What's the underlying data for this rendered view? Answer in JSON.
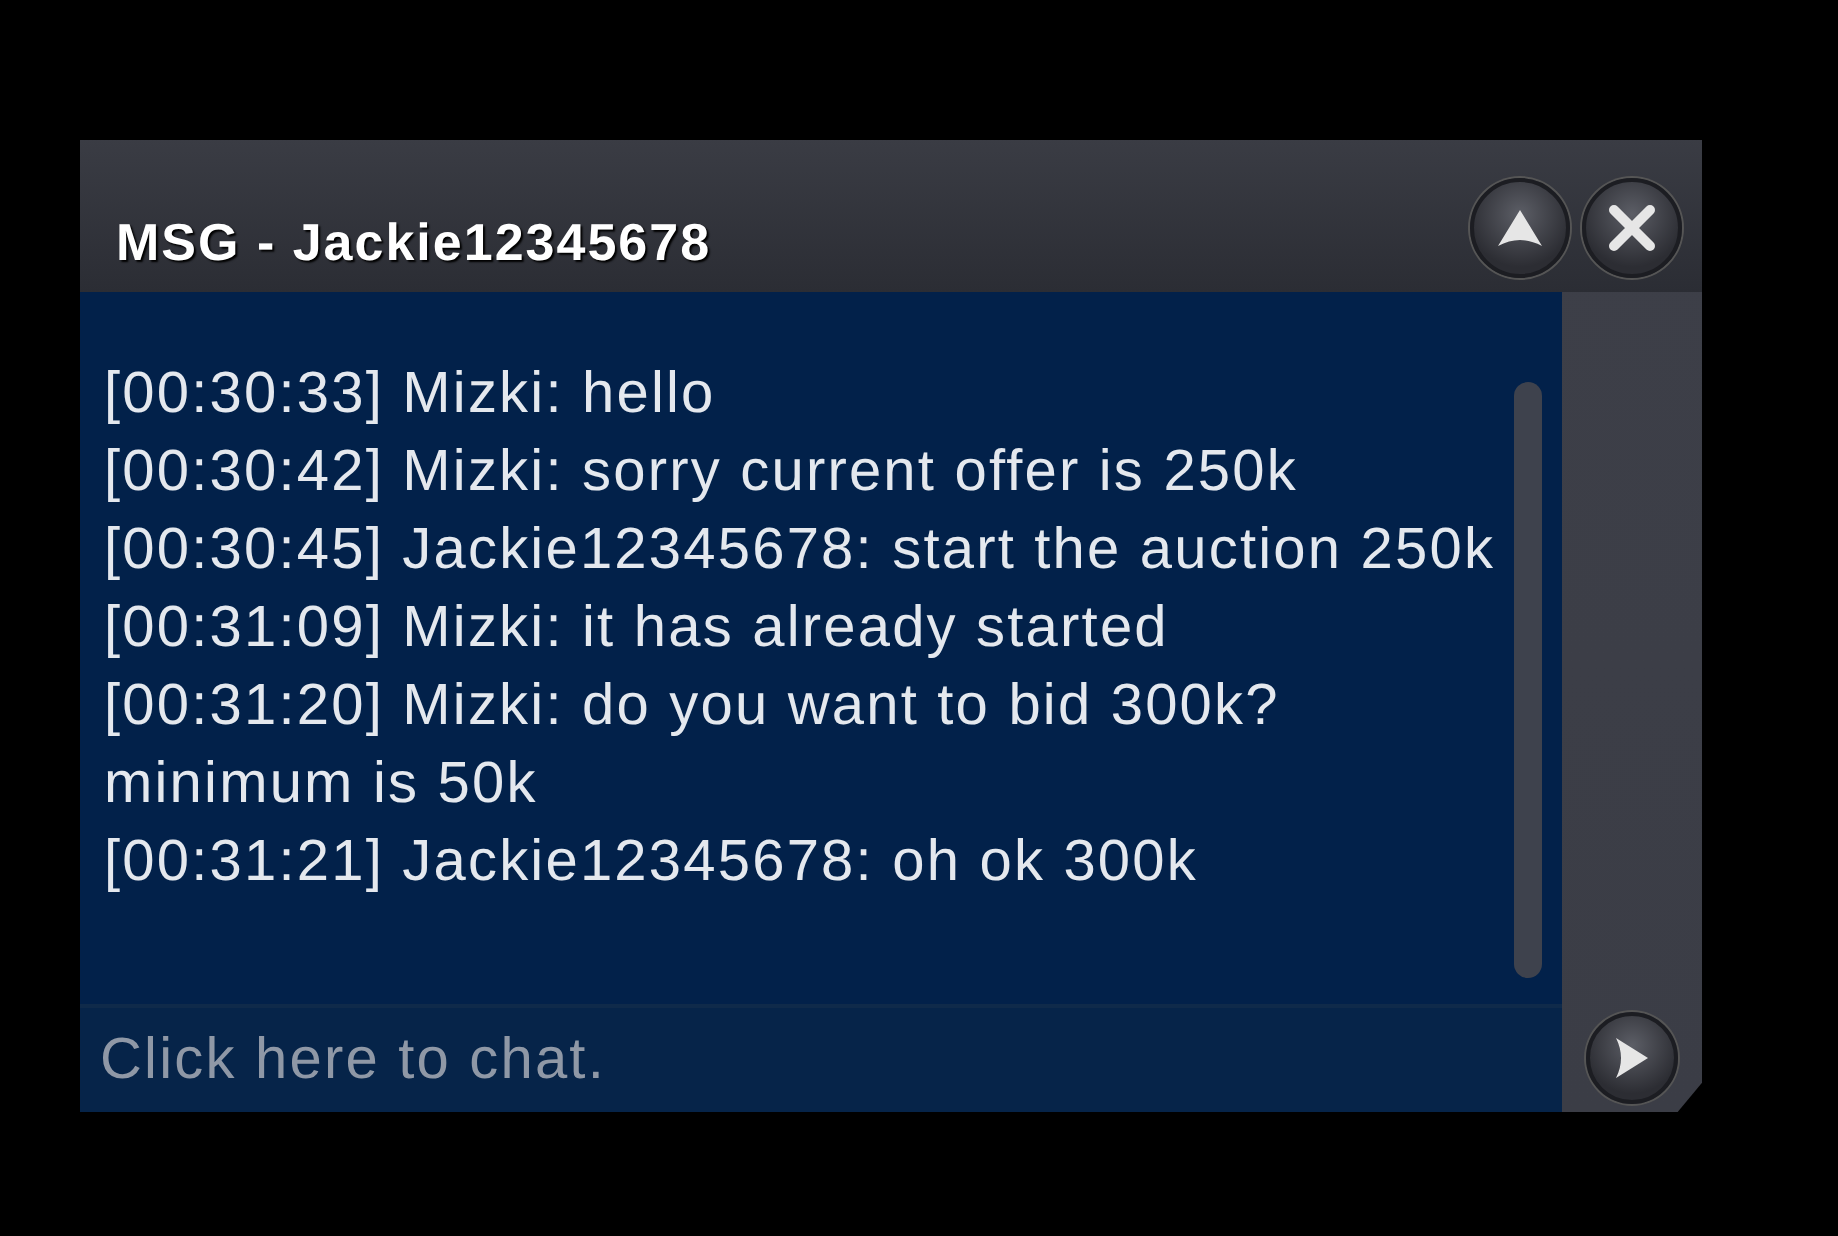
{
  "window": {
    "title": "MSG - Jackie12345678"
  },
  "messages": [
    {
      "text": "[00:30:33] Mizki: hello"
    },
    {
      "text": "[00:30:42] Mizki: sorry current offer is 250k"
    },
    {
      "text": "[00:30:45] Jackie12345678: start the auction 250k"
    },
    {
      "text": "[00:31:09] Mizki: it has already started"
    },
    {
      "text": "[00:31:20] Mizki: do you want to bid 300k? minimum is 50k"
    },
    {
      "text": "[00:31:21] Jackie12345678: oh ok 300k"
    }
  ],
  "chat_input": {
    "placeholder": "Click here to chat."
  }
}
